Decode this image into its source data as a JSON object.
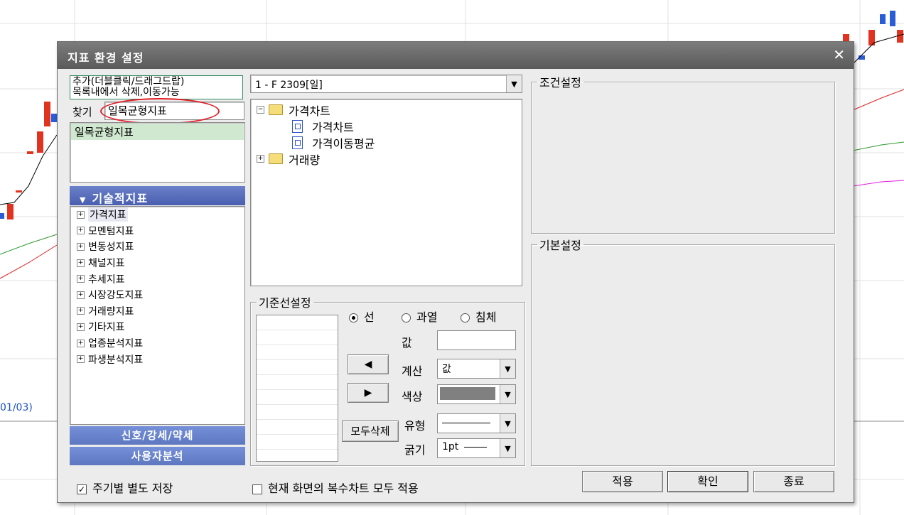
{
  "background": {
    "date_label": "01/03)"
  },
  "dialog": {
    "title": "지표 환경 설정",
    "close_icon": "✕",
    "help_lines": [
      "추가(더블클릭/드래그드랍)",
      "목록내에서 삭제,이동가능"
    ],
    "find_label": "찾기",
    "find_value": "일목균형지표",
    "search_results": [
      "일목균형지표"
    ],
    "technical_header": "기술적지표",
    "technical_items": [
      "가격지표",
      "모멘텀지표",
      "변동성지표",
      "채널지표",
      "추세지표",
      "시장강도지표",
      "거래량지표",
      "기타지표",
      "업종분석지표",
      "파생분석지표"
    ],
    "signal_button": "신호/강세/약세",
    "user_button": "사용자분석",
    "save_per_period": "주기별 별도 저장",
    "apply_all_charts": "현재 화면의 복수차트 모두 적용",
    "instrument_combo": "1 - F 2309[일]",
    "chart_tree": {
      "folder1": "가격차트",
      "child1": "가격차트",
      "child2": "가격이동평균",
      "folder2": "거래량"
    },
    "baseline": {
      "legend": "기준선설정",
      "radio_line": "선",
      "radio_overheat": "과열",
      "radio_sink": "침체",
      "value_label": "값",
      "value": "",
      "calc_label": "계산",
      "calc_value": "값",
      "color_label": "색상",
      "type_label": "유형",
      "width_label": "굵기",
      "width_value": "1pt",
      "delete_all": "모두삭제"
    },
    "condition_legend": "조건설정",
    "basic_legend": "기본설정",
    "buttons": {
      "apply": "적용",
      "ok": "확인",
      "close": "종료"
    }
  }
}
